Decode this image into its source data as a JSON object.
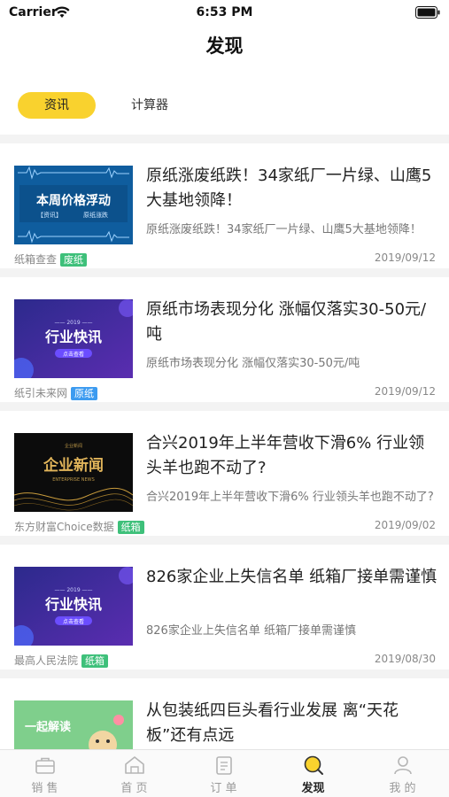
{
  "status_bar": {
    "carrier": "Carrier",
    "time": "6:53 PM"
  },
  "nav": {
    "title": "发现"
  },
  "tabs": [
    {
      "label": "资讯",
      "active": true
    },
    {
      "label": "计算器",
      "active": false
    }
  ],
  "thumb_text": {
    "t0": {
      "main": "本周价格浮动",
      "sub1": "【资讯】",
      "sub2": "原纸涨跌"
    },
    "t1": {
      "year": "—— 2019 ——",
      "main": "行业快讯",
      "btn": "点击查看"
    },
    "t2": {
      "small": "企业新闻",
      "main": "企业新闻",
      "sub": "ENTERPRISE NEWS"
    },
    "t3": {
      "year": "—— 2019 ——",
      "main": "行业快讯",
      "btn": "点击查看"
    },
    "t4": {
      "main": "一起解读"
    }
  },
  "articles": [
    {
      "title": "原纸涨废纸跌！34家纸厂一片绿、山鹰5大基地领降！",
      "summary": "原纸涨废纸跌！34家纸厂一片绿、山鹰5大基地领降！",
      "source": "纸箱查查",
      "tag": "废纸",
      "tag_color": "#3ec07a",
      "date": "2019/09/12"
    },
    {
      "title": "原纸市场表现分化 涨幅仅落实30-50元/吨",
      "summary": "原纸市场表现分化 涨幅仅落实30-50元/吨",
      "source": "纸引未来网",
      "tag": "原纸",
      "tag_color": "#3c9bf0",
      "date": "2019/09/12"
    },
    {
      "title": "合兴2019年上半年营收下滑6% 行业领头羊也跑不动了?",
      "summary": "合兴2019年上半年营收下滑6% 行业领头羊也跑不动了?",
      "source": "东方财富Choice数据",
      "tag": "纸箱",
      "tag_color": "#3ec07a",
      "date": "2019/09/02"
    },
    {
      "title": "826家企业上失信名单 纸箱厂接单需谨慎",
      "summary": "826家企业上失信名单 纸箱厂接单需谨慎",
      "source": "最高人民法院",
      "tag": "纸箱",
      "tag_color": "#3ec07a",
      "date": "2019/08/30"
    },
    {
      "title": "从包装纸四巨头看行业发展 离“天花板”还有点远",
      "summary": "",
      "source": "",
      "tag": "",
      "tag_color": "#3ec07a",
      "date": ""
    }
  ],
  "tab_bar": [
    {
      "label": "销 售",
      "icon": "briefcase-icon",
      "active": false
    },
    {
      "label": "首 页",
      "icon": "home-icon",
      "active": false
    },
    {
      "label": "订 单",
      "icon": "clipboard-icon",
      "active": false
    },
    {
      "label": "发现",
      "icon": "discover-icon",
      "active": true
    },
    {
      "label": "我 的",
      "icon": "user-icon",
      "active": false
    }
  ]
}
